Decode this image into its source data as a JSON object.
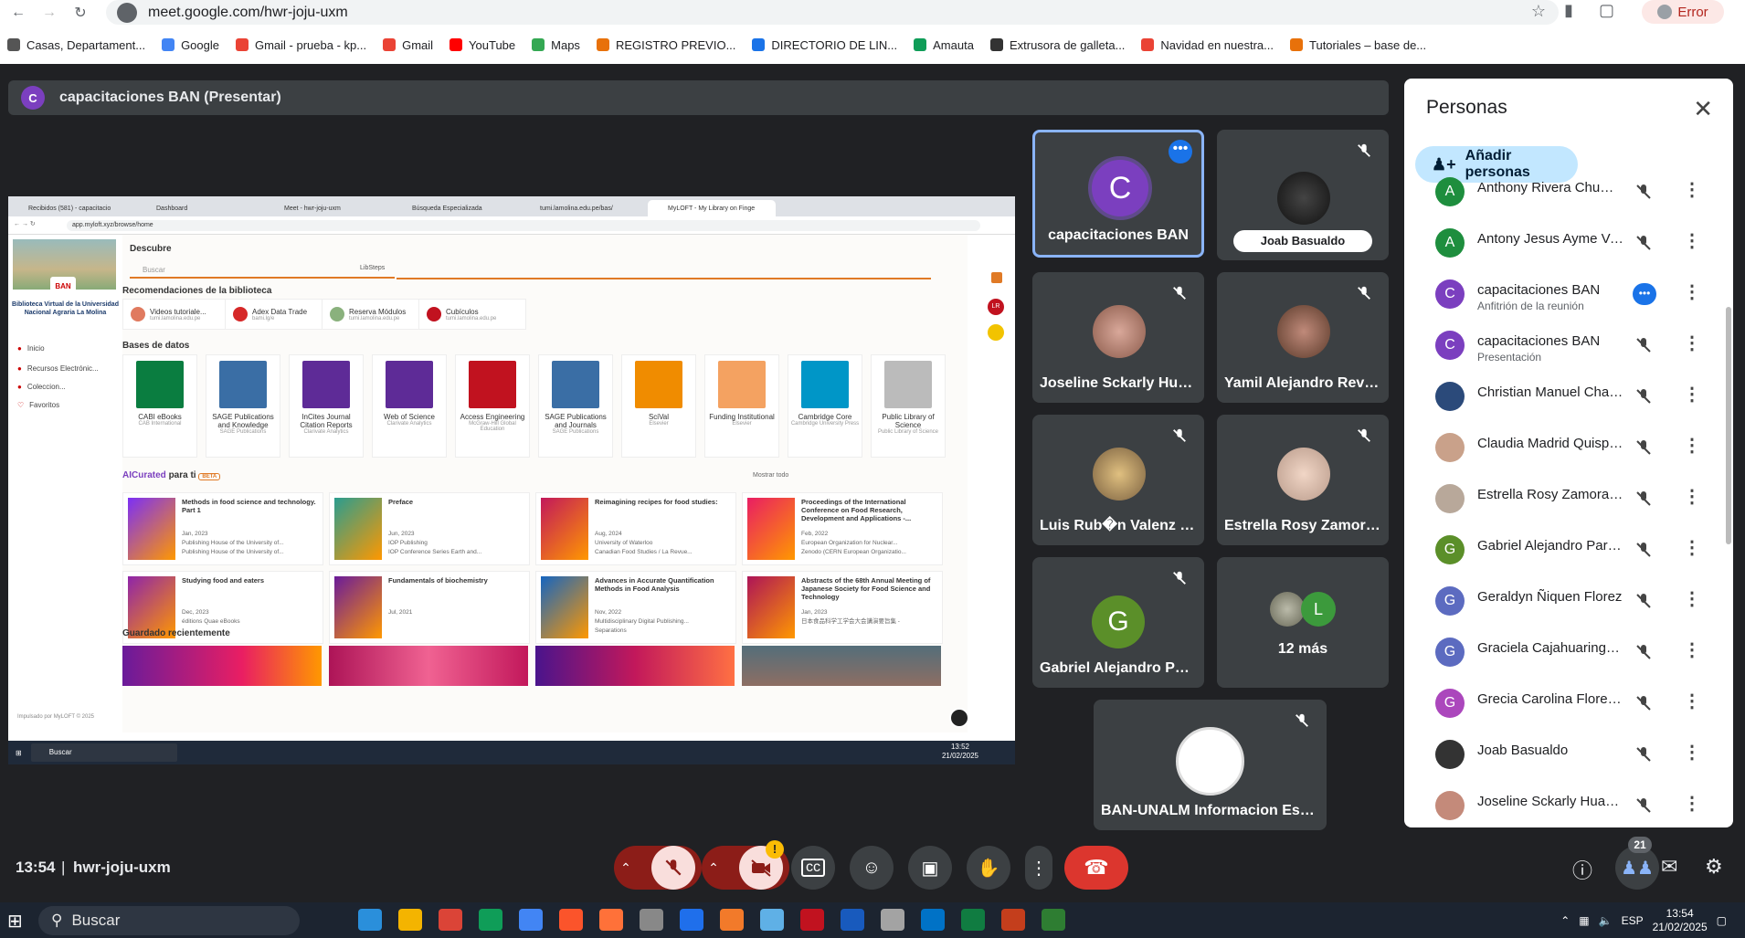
{
  "browser": {
    "url": "meet.google.com/hwr-joju-uxm",
    "error_label": "Error",
    "bookmarks": [
      {
        "label": "Casas, Departament...",
        "color": "#555"
      },
      {
        "label": "Google",
        "color": "#4285f4"
      },
      {
        "label": "Gmail - prueba - kp...",
        "color": "#ea4335"
      },
      {
        "label": "Gmail",
        "color": "#ea4335"
      },
      {
        "label": "YouTube",
        "color": "#ff0000"
      },
      {
        "label": "Maps",
        "color": "#34a853"
      },
      {
        "label": "REGISTRO PREVIO...",
        "color": "#e8710a"
      },
      {
        "label": "DIRECTORIO DE LIN...",
        "color": "#1a73e8"
      },
      {
        "label": "Amauta",
        "color": "#0f9d58"
      },
      {
        "label": "Extrusora de galleta...",
        "color": "#333"
      },
      {
        "label": "Navidad en nuestra...",
        "color": "#ea4335"
      },
      {
        "label": "Tutoriales – base de...",
        "color": "#e8710a"
      }
    ]
  },
  "presentation": {
    "initial": "C",
    "title": "capacitaciones BAN (Presentar)"
  },
  "shared_screen": {
    "tabs": [
      "Recibidos (581) - capacitacio",
      "Dashboard",
      "Meet - hwr-joju-uxm",
      "Búsqueda Especializada",
      "tumi.lamolina.edu.pe/bas/",
      "MyLOFT - My Library on Finge"
    ],
    "address": "app.myloft.xyz/browse/home",
    "logo_badge": "BAN",
    "logo_label": "Biblioteca Virtual de la Universidad Nacional Agraria La Molina",
    "nav": [
      "Inicio",
      "Recursos Electrónic...",
      "Coleccion...",
      "Favoritos"
    ],
    "discover": "Descubre",
    "search_placeholder": "Buscar",
    "library_label": "LibSteps",
    "recs_heading": "Recomendaciones de la biblioteca",
    "recs": [
      {
        "label": "Videos tutoriale...",
        "sub": "tumi.lamolina.edu.pe",
        "color": "#e07a5f"
      },
      {
        "label": "Adex Data Trade",
        "sub": "bami.lg/e",
        "color": "#d62828"
      },
      {
        "label": "Reserva Módulos",
        "sub": "tumi.lamolina.edu.pe",
        "color": "#8ab17d"
      },
      {
        "label": "Cubículos",
        "sub": "tumi.lamolina.edu.pe",
        "color": "#c1121f"
      }
    ],
    "db_heading": "Bases de datos",
    "databases": [
      {
        "label": "CABI eBooks",
        "sub": "CAB International",
        "color": "#0a7d40"
      },
      {
        "label": "SAGE Publications and Knowledge",
        "sub": "SAGE Publications",
        "color": "#3a6ea5"
      },
      {
        "label": "InCites Journal Citation Reports",
        "sub": "Clarivate Analytics",
        "color": "#5e2b97"
      },
      {
        "label": "Web of Science",
        "sub": "Clarivate Analytics",
        "color": "#5e2b97"
      },
      {
        "label": "Access Engineering",
        "sub": "McGraw-Hill Global Education",
        "color": "#c1121f"
      },
      {
        "label": "SAGE Publications and Journals",
        "sub": "SAGE Publications",
        "color": "#3a6ea5"
      },
      {
        "label": "SciVal",
        "sub": "Elsevier",
        "color": "#f08c00"
      },
      {
        "label": "Funding Institutional",
        "sub": "Elsevier",
        "color": "#f4a261"
      },
      {
        "label": "Cambridge Core",
        "sub": "Cambridge University Press",
        "color": "#0096c7"
      },
      {
        "label": "Public Library of Science",
        "sub": "Public Library of Science",
        "color": "#bbbbbb"
      }
    ],
    "ai_heading": "AICurated",
    "ai_heading_suffix": "para ti",
    "beta": "BETA",
    "show_all": "Mostrar todo",
    "curated": [
      {
        "title": "Methods in food science and technology. Part 1",
        "date": "Jan, 2023",
        "pub1": "Publishing House of the University of...",
        "pub2": "Publishing House of the University of...",
        "color": "#7b2ff7"
      },
      {
        "title": "Preface",
        "date": "Jun, 2023",
        "pub1": "IOP Publishing",
        "pub2": "IOP Conference Series Earth and...",
        "color": "#2a9d8f"
      },
      {
        "title": "Reimagining recipes for food studies:",
        "date": "Aug, 2024",
        "pub1": "University of Waterloo",
        "pub2": "Canadian Food Studies / La Revue...",
        "color": "#c2185b"
      },
      {
        "title": "Proceedings of the International Conference on Food Research, Development and Applications -...",
        "date": "Feb, 2022",
        "pub1": "European Organization for Nuclear...",
        "pub2": "Zenodo (CERN European Organizatio...",
        "color": "#e91e63"
      },
      {
        "title": "Studying food and eaters",
        "date": "Dec, 2023",
        "pub1": "éditions Quae eBooks",
        "pub2": "",
        "color": "#8e24aa"
      },
      {
        "title": "Fundamentals of biochemistry",
        "date": "Jul, 2021",
        "pub1": "",
        "pub2": "",
        "color": "#6a1b9a"
      },
      {
        "title": "Advances in Accurate Quantification Methods in Food Analysis",
        "date": "Nov, 2022",
        "pub1": "Multidisciplinary Digital Publishing...",
        "pub2": "Separations",
        "color": "#1565c0"
      },
      {
        "title": "Abstracts of the 68th Annual Meeting of Japanese Society for Food Science and Technology",
        "date": "Jan, 2023",
        "pub1": "日本食品科学工学会大会講演要旨集 -",
        "pub2": "",
        "color": "#ad1457"
      }
    ],
    "saved_heading": "Guardado recientemente",
    "footer": "Impulsado por MyLOFT © 2025",
    "taskbar_search": "Buscar",
    "taskbar_time": "13:52",
    "taskbar_date": "21/02/2025"
  },
  "tiles": [
    {
      "name": "capacitaciones BAN",
      "initial": "C",
      "avatar_color": "#7b3fbf"
    },
    {
      "name": "Joab Basualdo"
    },
    {
      "name": "Joseline Sckarly Huap..."
    },
    {
      "name": "Yamil Alejandro Revill..."
    },
    {
      "name": "Luis Rub�n Valenz Ca..."
    },
    {
      "name": "Estrella Rosy Zamora ..."
    },
    {
      "name": "Gabriel Alejandro Par...",
      "initial": "G",
      "avatar_color": "#5b8f29"
    },
    {
      "name": "12 más",
      "initial": "L",
      "avatar_color": "#3c9a3c"
    },
    {
      "name": "BAN-UNALM Informacion Espe..."
    }
  ],
  "people_panel": {
    "title": "Personas",
    "add_button": "Añadir personas",
    "people": [
      {
        "name": "Anthony Rivera Chumpi...",
        "initial": "A",
        "color": "#1e8e3e",
        "sub": ""
      },
      {
        "name": "Antony Jesus Ayme Ven...",
        "initial": "A",
        "color": "#1e8e3e",
        "sub": ""
      },
      {
        "name": "capacitaciones BAN",
        "initial": "C",
        "color": "#7b3fbf",
        "sub": "Anfitrión de la reunión"
      },
      {
        "name": "capacitaciones BAN",
        "initial": "C",
        "color": "#7b3fbf",
        "sub": "Presentación"
      },
      {
        "name": "Christian Manuel Chanc...",
        "initial": "",
        "color": "#2b4a7a",
        "sub": ""
      },
      {
        "name": "Claudia Madrid Quispe ...",
        "initial": "",
        "color": "#c9a18a",
        "sub": ""
      },
      {
        "name": "Estrella Rosy Zamora C...",
        "initial": "",
        "color": "#b8a89a",
        "sub": ""
      },
      {
        "name": "Gabriel Alejandro Pardo...",
        "initial": "G",
        "color": "#5b8f29",
        "sub": ""
      },
      {
        "name": "Geraldyn Ñiquen Florez",
        "initial": "G",
        "color": "#5c6bc0",
        "sub": ""
      },
      {
        "name": "Graciela Cajahuaringa ...",
        "initial": "G",
        "color": "#5c6bc0",
        "sub": ""
      },
      {
        "name": "Grecia Carolina Flores B...",
        "initial": "G",
        "color": "#ab47bc",
        "sub": ""
      },
      {
        "name": "Joab Basualdo",
        "initial": "",
        "color": "#333333",
        "sub": ""
      },
      {
        "name": "Joseline Sckarly Huapa...",
        "initial": "",
        "color": "#c48a7a",
        "sub": ""
      }
    ]
  },
  "controls": {
    "time": "13:54",
    "separator": "|",
    "meeting_code": "hwr-joju-uxm",
    "people_count": "21",
    "warning_badge": "!"
  },
  "taskbar": {
    "search_placeholder": "Buscar",
    "language": "ESP",
    "time": "13:54",
    "date": "21/02/2025"
  }
}
